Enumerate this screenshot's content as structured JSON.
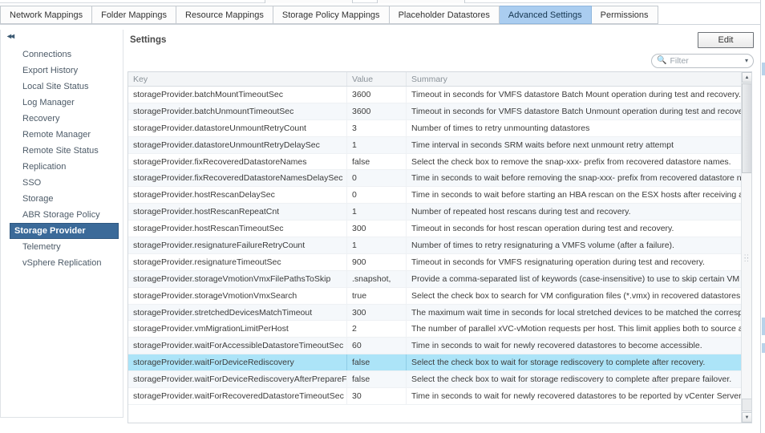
{
  "window": {
    "top_segments": 3
  },
  "tabs": [
    {
      "label": "Network Mappings",
      "active": false
    },
    {
      "label": "Folder Mappings",
      "active": false
    },
    {
      "label": "Resource Mappings",
      "active": false
    },
    {
      "label": "Storage Policy Mappings",
      "active": false
    },
    {
      "label": "Placeholder Datastores",
      "active": false
    },
    {
      "label": "Advanced Settings",
      "active": true
    },
    {
      "label": "Permissions",
      "active": false
    }
  ],
  "sidebar": {
    "collapse_icon": "◂◂",
    "items": [
      {
        "label": "Connections",
        "active": false
      },
      {
        "label": "Export History",
        "active": false
      },
      {
        "label": "Local Site Status",
        "active": false
      },
      {
        "label": "Log Manager",
        "active": false
      },
      {
        "label": "Recovery",
        "active": false
      },
      {
        "label": "Remote Manager",
        "active": false
      },
      {
        "label": "Remote Site Status",
        "active": false
      },
      {
        "label": "Replication",
        "active": false
      },
      {
        "label": "SSO",
        "active": false
      },
      {
        "label": "Storage",
        "active": false
      },
      {
        "label": "ABR Storage Policy",
        "active": false
      },
      {
        "label": "Storage Provider",
        "active": true
      },
      {
        "label": "Telemetry",
        "active": false
      },
      {
        "label": "vSphere Replication",
        "active": false
      }
    ]
  },
  "content": {
    "title": "Settings",
    "edit_label": "Edit",
    "filter": {
      "icon": "search-icon",
      "value": "",
      "placeholder": "Filter",
      "caret": "▾"
    }
  },
  "table": {
    "columns": [
      "Key",
      "Value",
      "Summary"
    ],
    "selected_index": 16,
    "rows": [
      {
        "key": "storageProvider.batchMountTimeoutSec",
        "value": "3600",
        "summary": "Timeout in seconds for VMFS datastore Batch Mount operation during test and recovery."
      },
      {
        "key": "storageProvider.batchUnmountTimeoutSec",
        "value": "3600",
        "summary": "Timeout in seconds for VMFS datastore Batch Unmount operation during test and recovery."
      },
      {
        "key": "storageProvider.datastoreUnmountRetryCount",
        "value": "3",
        "summary": "Number of times to retry unmounting datastores"
      },
      {
        "key": "storageProvider.datastoreUnmountRetryDelaySec",
        "value": "1",
        "summary": "Time interval in seconds SRM waits before next unmount retry attempt"
      },
      {
        "key": "storageProvider.fixRecoveredDatastoreNames",
        "value": "false",
        "summary": "Select the check box to remove the snap-xxx- prefix from recovered datastore names."
      },
      {
        "key": "storageProvider.fixRecoveredDatastoreNamesDelaySec",
        "value": "0",
        "summary": "Time in seconds to wait before removing the snap-xxx- prefix from recovered datastore na..."
      },
      {
        "key": "storageProvider.hostRescanDelaySec",
        "value": "0",
        "summary": "Time in seconds to wait before starting an HBA rescan on the ESX hosts after receiving a r..."
      },
      {
        "key": "storageProvider.hostRescanRepeatCnt",
        "value": "1",
        "summary": "Number of repeated host rescans during test and recovery."
      },
      {
        "key": "storageProvider.hostRescanTimeoutSec",
        "value": "300",
        "summary": "Timeout in seconds for host rescan operation during test and recovery."
      },
      {
        "key": "storageProvider.resignatureFailureRetryCount",
        "value": "1",
        "summary": "Number of times to retry resignaturing a VMFS volume (after a failure)."
      },
      {
        "key": "storageProvider.resignatureTimeoutSec",
        "value": "900",
        "summary": "Timeout in seconds for VMFS resignaturing operation during test and recovery."
      },
      {
        "key": "storageProvider.storageVmotionVmxFilePathsToSkip",
        "value": ".snapshot,",
        "summary": "Provide a comma-separated list of keywords (case-insensitive) to use to skip certain VM co..."
      },
      {
        "key": "storageProvider.storageVmotionVmxSearch",
        "value": "true",
        "summary": "Select the check box to search for VM configuration files (*.vmx) in recovered datastores to ..."
      },
      {
        "key": "storageProvider.stretchedDevicesMatchTimeout",
        "value": "300",
        "summary": "The maximum wait time in seconds for local stretched devices to be matched the correspon..."
      },
      {
        "key": "storageProvider.vmMigrationLimitPerHost",
        "value": "2",
        "summary": "The number of parallel xVC-vMotion requests per host. This limit applies both to source an..."
      },
      {
        "key": "storageProvider.waitForAccessibleDatastoreTimeoutSec",
        "value": "60",
        "summary": "Time in seconds to wait for newly recovered datastores to become accessible."
      },
      {
        "key": "storageProvider.waitForDeviceRediscovery",
        "value": "false",
        "summary": "Select the check box to wait for storage rediscovery to complete after recovery."
      },
      {
        "key": "storageProvider.waitForDeviceRediscoveryAfterPrepareFa...",
        "value": "false",
        "summary": "Select the check box to wait for storage rediscovery to complete after prepare failover."
      },
      {
        "key": "storageProvider.waitForRecoveredDatastoreTimeoutSec",
        "value": "30",
        "summary": "Time in seconds to wait for newly recovered datastores to be reported by vCenter Server."
      }
    ]
  },
  "scrollbar": {
    "up_arrow": "▲",
    "down_arrow": "▼"
  },
  "colors": {
    "tab_active_bg": "#aacdf0",
    "sidebar_active_bg": "#3b6a99",
    "row_selected_bg": "#ace4f8",
    "row_stripe_bg": "#f5f8fb"
  }
}
